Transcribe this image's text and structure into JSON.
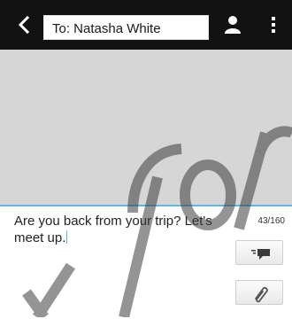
{
  "header": {
    "to_field": "To: Natasha White"
  },
  "compose": {
    "message": "Are you back from your trip? Let's meet up.",
    "counter": "43/160"
  },
  "icons": {
    "back": "back-arrow-icon",
    "contact": "person-icon",
    "menu": "overflow-menu-icon",
    "send": "send-message-icon",
    "attach": "paperclip-icon"
  },
  "colors": {
    "top_bar": "#121212",
    "accent": "#5eb7e8"
  }
}
